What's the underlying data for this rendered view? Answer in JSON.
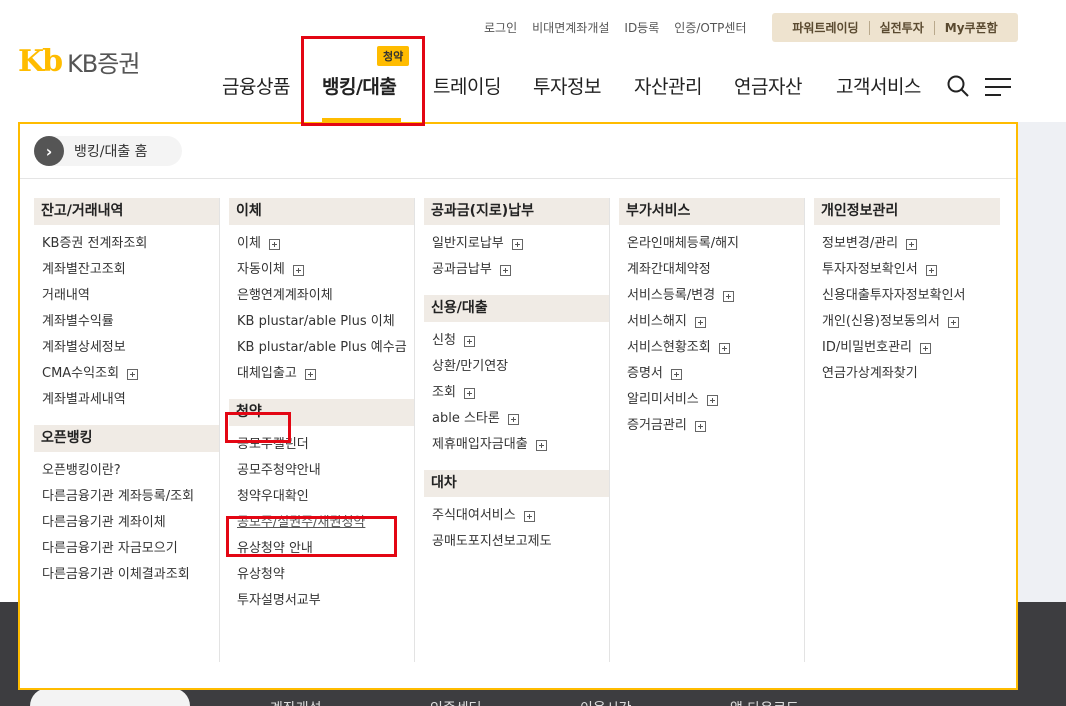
{
  "header": {
    "util_links": [
      "로그인",
      "비대면계좌개설",
      "ID등록",
      "인증/OTP센터"
    ],
    "util_box": [
      "파워트레이딩",
      "실전투자",
      "My쿠폰함"
    ],
    "logo_mark": "Kb",
    "logo_name": "KB증권",
    "badge": "청약",
    "gnb": [
      "금융상품",
      "뱅킹/대출",
      "트레이딩",
      "투자정보",
      "자산관리",
      "연금자산",
      "고객서비스"
    ]
  },
  "panel": {
    "home_label": "뱅킹/대출 홈",
    "columns": [
      {
        "sections": [
          {
            "title": "잔고/거래내역",
            "items": [
              {
                "label": "KB증권 전계좌조회",
                "plus": false
              },
              {
                "label": "계좌별잔고조회",
                "plus": false
              },
              {
                "label": "거래내역",
                "plus": false
              },
              {
                "label": "계좌별수익률",
                "plus": false
              },
              {
                "label": "계좌별상세정보",
                "plus": false
              },
              {
                "label": "CMA수익조회",
                "plus": true
              },
              {
                "label": "계좌별과세내역",
                "plus": false
              }
            ]
          },
          {
            "title": "오픈뱅킹",
            "items": [
              {
                "label": "오픈뱅킹이란?",
                "plus": false
              },
              {
                "label": "다른금융기관 계좌등록/조회",
                "plus": false
              },
              {
                "label": "다른금융기관 계좌이체",
                "plus": false
              },
              {
                "label": "다른금융기관 자금모으기",
                "plus": false
              },
              {
                "label": "다른금융기관 이체결과조회",
                "plus": false
              }
            ]
          }
        ]
      },
      {
        "sections": [
          {
            "title": "이체",
            "items": [
              {
                "label": "이체",
                "plus": true
              },
              {
                "label": "자동이체",
                "plus": true
              },
              {
                "label": "은행연계계좌이체",
                "plus": false
              },
              {
                "label": "KB plustar/able Plus 이체",
                "plus": false
              },
              {
                "label": "KB plustar/able Plus 예수금",
                "plus": false
              },
              {
                "label": "대체입출고",
                "plus": true
              }
            ]
          },
          {
            "title": "청약",
            "items": [
              {
                "label": "공모주캘린더",
                "plus": false
              },
              {
                "label": "공모주청약안내",
                "plus": false
              },
              {
                "label": "청약우대확인",
                "plus": false
              },
              {
                "label": "공모주/실권주/채권청약",
                "plus": false
              },
              {
                "label": "유상청약 안내",
                "plus": false
              },
              {
                "label": "유상청약",
                "plus": false
              },
              {
                "label": "투자설명서교부",
                "plus": false
              }
            ]
          }
        ]
      },
      {
        "sections": [
          {
            "title": "공과금(지로)납부",
            "items": [
              {
                "label": "일반지로납부",
                "plus": true
              },
              {
                "label": "공과금납부",
                "plus": true
              }
            ]
          },
          {
            "title": "신용/대출",
            "items": [
              {
                "label": "신청",
                "plus": true
              },
              {
                "label": "상환/만기연장",
                "plus": false
              },
              {
                "label": "조회",
                "plus": true
              },
              {
                "label": "able 스타론",
                "plus": true
              },
              {
                "label": "제휴매입자금대출",
                "plus": true
              }
            ]
          },
          {
            "title": "대차",
            "items": [
              {
                "label": "주식대여서비스",
                "plus": true
              },
              {
                "label": "공매도포지션보고제도",
                "plus": false
              }
            ]
          }
        ]
      },
      {
        "sections": [
          {
            "title": "부가서비스",
            "items": [
              {
                "label": "온라인매체등록/해지",
                "plus": false
              },
              {
                "label": "계좌간대체약정",
                "plus": false
              },
              {
                "label": "서비스등록/변경",
                "plus": true
              },
              {
                "label": "서비스해지",
                "plus": true
              },
              {
                "label": "서비스현황조회",
                "plus": true
              },
              {
                "label": "증명서",
                "plus": true
              },
              {
                "label": "알리미서비스",
                "plus": true
              },
              {
                "label": "증거금관리",
                "plus": true
              }
            ]
          }
        ]
      },
      {
        "sections": [
          {
            "title": "개인정보관리",
            "items": [
              {
                "label": "정보변경/관리",
                "plus": true
              },
              {
                "label": "투자자정보확인서",
                "plus": true
              },
              {
                "label": "신용대출투자자정보확인서",
                "plus": false
              },
              {
                "label": "개인(신용)정보동의서",
                "plus": true
              },
              {
                "label": "ID/비밀번호관리",
                "plus": true
              },
              {
                "label": "연금가상계좌찾기",
                "plus": false
              }
            ]
          }
        ]
      }
    ]
  },
  "footer": {
    "links": [
      "계좌개설",
      "인증센터",
      "이용시간",
      "앱 다운로드"
    ]
  },
  "colors": {
    "accent": "#ffbc00",
    "highlight": "#e30613"
  }
}
